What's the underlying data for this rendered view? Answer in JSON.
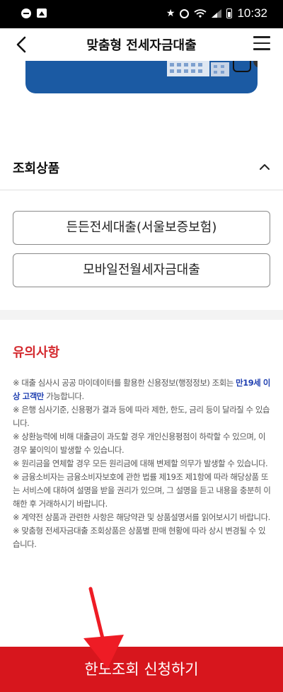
{
  "status_bar": {
    "time": "10:32"
  },
  "header": {
    "title": "맞춤형 전세자금대출"
  },
  "section": {
    "title": "조회상품"
  },
  "products": [
    {
      "label": "든든전세대출(서울보증보험)"
    },
    {
      "label": "모바일전월세자금대출"
    }
  ],
  "notice": {
    "title": "유의사항",
    "items": [
      {
        "before": "※ 대출 심사시 공공 마이데이터를 활용한 신용정보(행정정보) 조회는 ",
        "highlight": "만19세 이상 고객만",
        "after": " 가능합니다."
      },
      {
        "text": "※ 은행 심사기준, 신용평가 결과 등에 따라 제한, 한도, 금리 등이 달라질 수 있습니다."
      },
      {
        "text": "※ 상환능력에 비해 대출금이 과도할 경우 개인신용평점이 하락할 수 있으며, 이 경우 불이익이 발생할 수 있습니다."
      },
      {
        "text": "※ 원리금을 연체할 경우 모든 원리금에 대해 변제할 의무가 발생할 수 있습니다."
      },
      {
        "text": "※ 금융소비자는 금융소비자보호에 관한 법률 제19조 제1항에 따라 해당상품 또는 서비스에 대하여 설명을 받을 권리가 있으며, 그 설명을 듣고 내용을 충분히 이해한 후 거래하시기 바랍니다."
      },
      {
        "text": "※ 계약전 상품과 관련한 사항은 해당약관 및 상품설명서를 읽어보시기 바랍니다."
      },
      {
        "text": "※ 맞춤형 전세자금대출 조회상품은 상품별 판매 현황에 따라 상시 변경될 수 있습니다."
      }
    ]
  },
  "cta": {
    "label": "한도조회 신청하기"
  },
  "colors": {
    "accent_red": "#d7161d",
    "notice_title": "#d42a2f",
    "highlight_blue": "#1f3fb0",
    "banner_blue": "#1b5aa3"
  },
  "icons": {
    "back": "chevron-left-icon",
    "menu": "hamburger-menu-icon",
    "collapse": "chevron-up-icon"
  }
}
